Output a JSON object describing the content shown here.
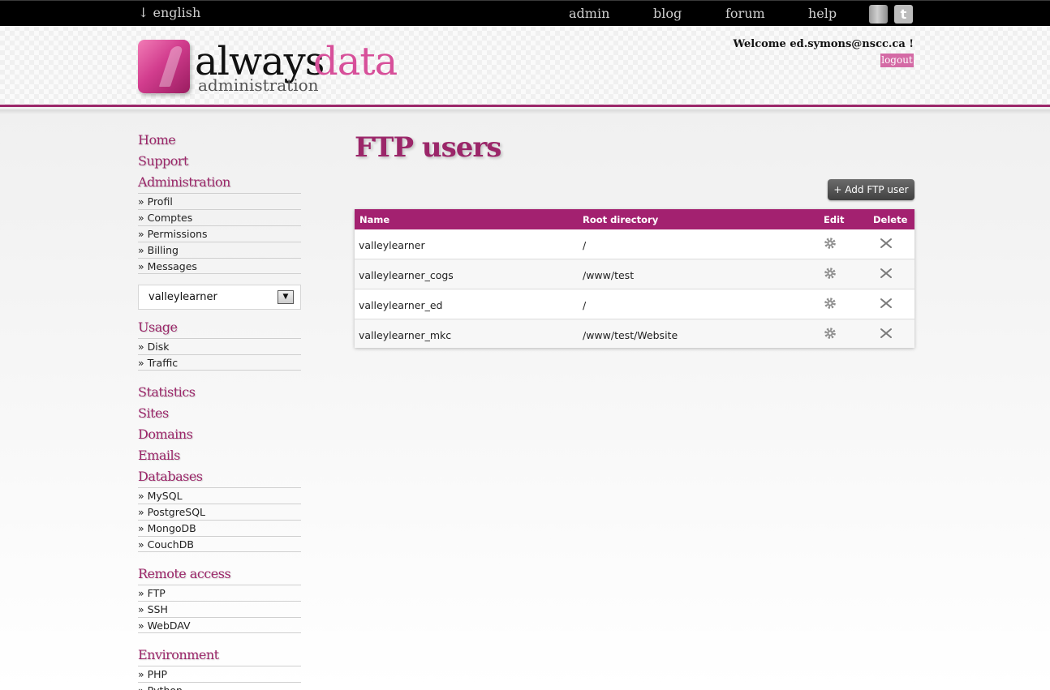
{
  "topbar": {
    "language": "↓ english",
    "nav": [
      "admin",
      "blog",
      "forum",
      "help"
    ],
    "social_icons": [
      "book-icon",
      "twitter-icon"
    ]
  },
  "header": {
    "logo_primary": "always",
    "logo_secondary": "data",
    "logo_subtitle": "administration",
    "welcome": "Welcome ed.symons@nscc.ca !",
    "logout": "logout"
  },
  "sidebar": {
    "home": "Home",
    "support": "Support",
    "administration": "Administration",
    "admin_items": [
      "» Profil",
      "» Comptes",
      "» Permissions",
      "» Billing",
      "» Messages"
    ],
    "account_select": "valleylearner",
    "usage": "Usage",
    "usage_items": [
      "» Disk",
      "» Traffic"
    ],
    "statistics": "Statistics",
    "sites": "Sites",
    "domains": "Domains",
    "emails": "Emails",
    "databases": "Databases",
    "database_items": [
      "» MySQL",
      "» PostgreSQL",
      "» MongoDB",
      "» CouchDB"
    ],
    "remote_access": "Remote access",
    "remote_items": [
      "» FTP",
      "» SSH",
      "» WebDAV"
    ],
    "environment": "Environment",
    "environment_items": [
      "» PHP",
      "» Python"
    ]
  },
  "main": {
    "title": "FTP users",
    "add_button": "+ Add FTP user",
    "table": {
      "headers": [
        "Name",
        "Root directory",
        "Edit",
        "Delete"
      ],
      "rows": [
        {
          "name": "valleylearner",
          "root": "/"
        },
        {
          "name": "valleylearner_cogs",
          "root": "/www/test"
        },
        {
          "name": "valleylearner_ed",
          "root": "/"
        },
        {
          "name": "valleylearner_mkc",
          "root": "/www/test/Website"
        }
      ]
    }
  },
  "colors": {
    "brand": "#9b2669",
    "header_row": "#a32170",
    "logo_pink": "#d7509a",
    "logout_bg": "#d46aa5"
  }
}
